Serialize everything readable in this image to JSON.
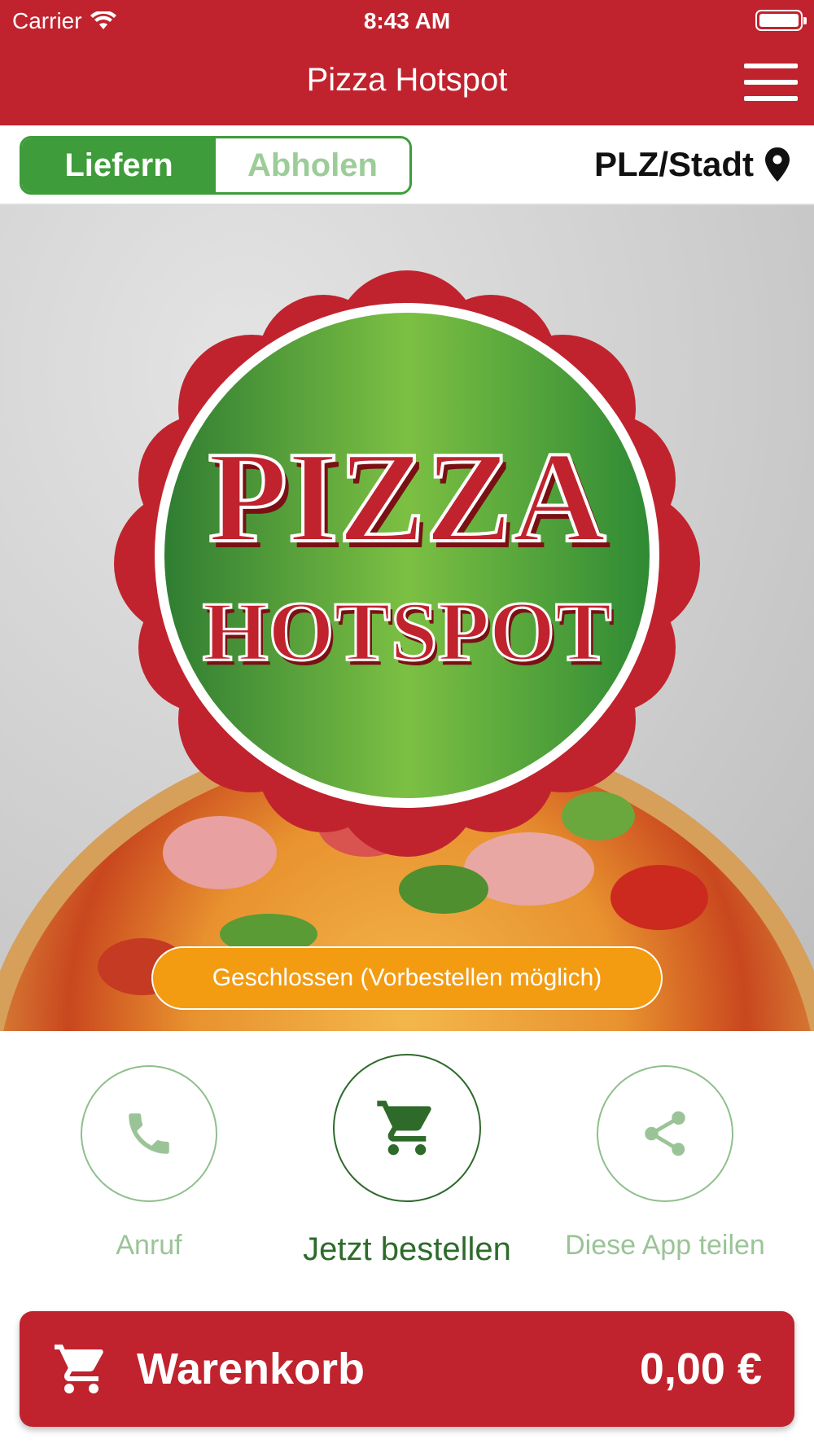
{
  "status_bar": {
    "carrier": "Carrier",
    "time": "8:43 AM"
  },
  "nav": {
    "title": "Pizza Hotspot"
  },
  "mode": {
    "deliver": "Liefern",
    "pickup": "Abholen",
    "location": "PLZ/Stadt"
  },
  "hero": {
    "logo_line1": "PIZZA",
    "logo_line2": "HOTSPOT",
    "status_text": "Geschlossen (Vorbestellen möglich)"
  },
  "actions": {
    "call": "Anruf",
    "order": "Jetzt bestellen",
    "share": "Diese App teilen"
  },
  "cart": {
    "label": "Warenkorb",
    "total": "0,00 €"
  },
  "colors": {
    "brand_red": "#c0232e",
    "brand_green": "#3e9c3a",
    "status_orange": "#f39c12"
  }
}
